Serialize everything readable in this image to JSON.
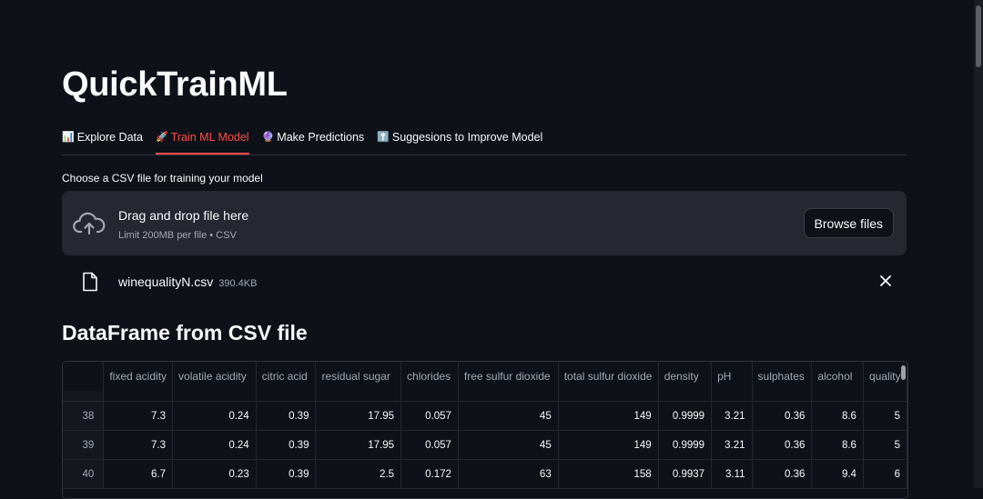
{
  "app": {
    "title": "QuickTrainML"
  },
  "tabs": [
    {
      "icon": "📊",
      "label": "Explore Data",
      "active": false
    },
    {
      "icon": "🚀",
      "label": "Train ML Model",
      "active": true
    },
    {
      "icon": "🔮",
      "label": "Make Predictions",
      "active": false
    },
    {
      "icon": "⬆️",
      "label": "Suggesions to Improve Model",
      "active": false
    }
  ],
  "uploader": {
    "label": "Choose a CSV file for training your model",
    "drop_title": "Drag and drop file here",
    "drop_subtitle": "Limit 200MB per file • CSV",
    "browse_label": "Browse files",
    "file_name": "winequalityN.csv",
    "file_size": "390.4KB"
  },
  "dataframe": {
    "heading": "DataFrame from CSV file",
    "columns": [
      "fixed acidity",
      "volatile acidity",
      "citric acid",
      "residual sugar",
      "chlorides",
      "free sulfur dioxide",
      "total sulfur dioxide",
      "density",
      "pH",
      "sulphates",
      "alcohol",
      "quality"
    ],
    "rows": [
      {
        "index": "38",
        "cells": [
          "7.3",
          "0.24",
          "0.39",
          "17.95",
          "0.057",
          "45",
          "149",
          "0.9999",
          "3.21",
          "0.36",
          "8.6",
          "5"
        ]
      },
      {
        "index": "39",
        "cells": [
          "7.3",
          "0.24",
          "0.39",
          "17.95",
          "0.057",
          "45",
          "149",
          "0.9999",
          "3.21",
          "0.36",
          "8.6",
          "5"
        ]
      },
      {
        "index": "40",
        "cells": [
          "6.7",
          "0.23",
          "0.39",
          "2.5",
          "0.172",
          "63",
          "158",
          "0.9937",
          "3.11",
          "0.36",
          "9.4",
          "6"
        ]
      }
    ]
  },
  "colors": {
    "background": "#0e1117",
    "accent": "#ff4b4b",
    "surface": "#262730"
  }
}
